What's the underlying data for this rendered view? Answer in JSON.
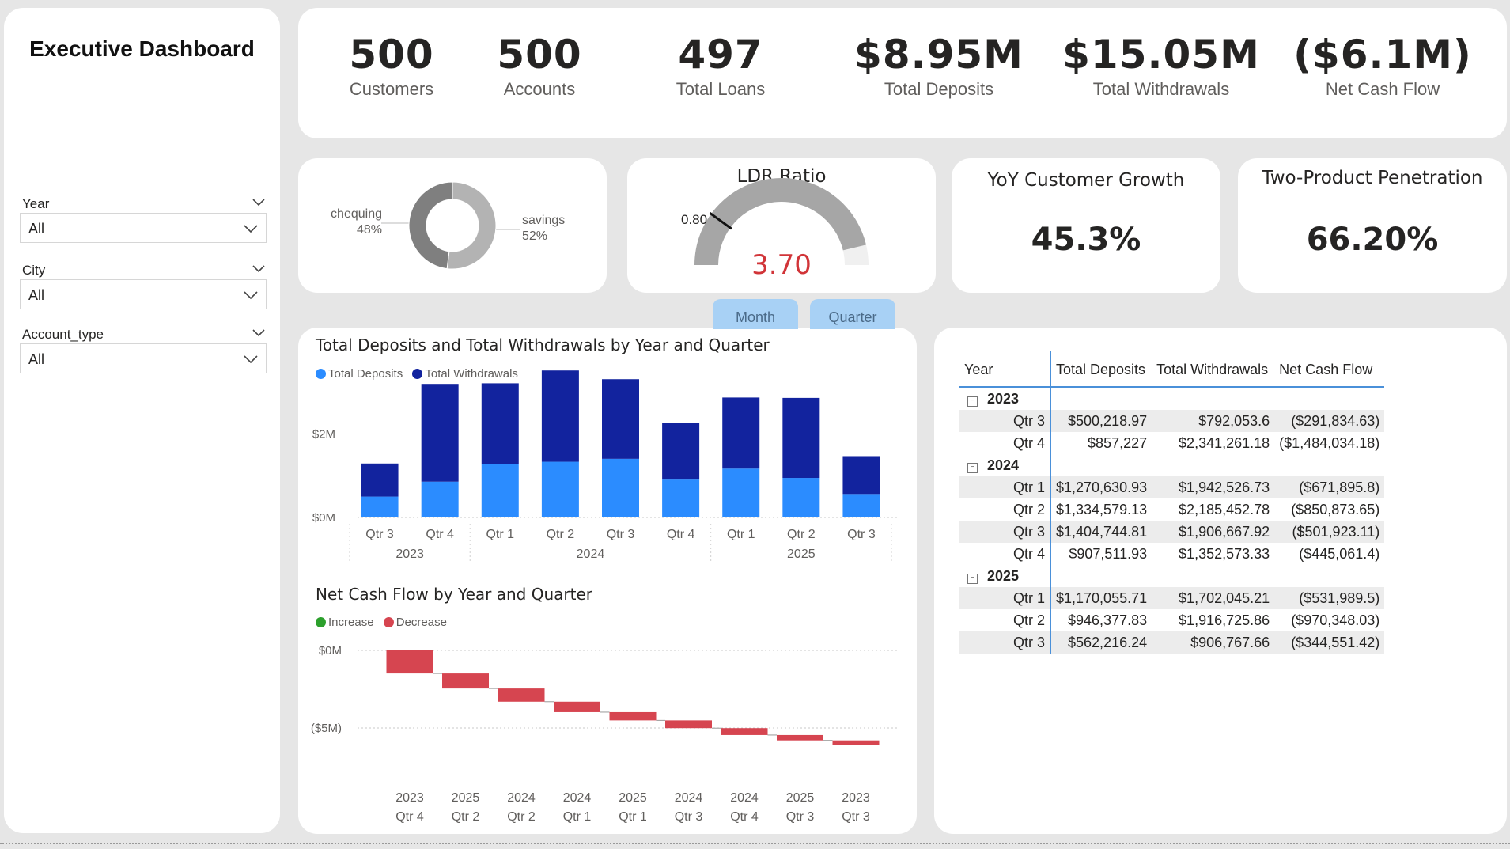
{
  "sidebar": {
    "title": "Executive Dashboard",
    "slicers": [
      {
        "label": "Year",
        "value": "All"
      },
      {
        "label": "City",
        "value": "All"
      },
      {
        "label": "Account_type",
        "value": "All"
      }
    ]
  },
  "kpis": [
    {
      "value": "500",
      "label": "Customers"
    },
    {
      "value": "500",
      "label": "Accounts"
    },
    {
      "value": "497",
      "label": "Total Loans"
    },
    {
      "value": "$8.95M",
      "label": "Total Deposits"
    },
    {
      "value": "$15.05M",
      "label": "Total Withdrawals"
    },
    {
      "value": "($6.1M)",
      "label": "Net Cash Flow"
    }
  ],
  "donut": {
    "slices": [
      {
        "name": "chequing",
        "pct": "48%",
        "value": 48,
        "color": "#7f7f7f"
      },
      {
        "name": "savings",
        "pct": "52%",
        "value": 52,
        "color": "#b3b3b3"
      }
    ]
  },
  "gauge": {
    "title": "LDR Ratio",
    "value": "3.70",
    "target": "0.80",
    "target_value": 0.8,
    "max": 4.0,
    "actual": 3.7,
    "value_color": "#d13438"
  },
  "growth": {
    "title": "YoY Customer Growth",
    "value": "45.3%"
  },
  "penetration": {
    "title": "Two-Product Penetration",
    "value": "66.20%"
  },
  "buttons": {
    "month": "Month",
    "quarter": "Quarter"
  },
  "chart_data": [
    {
      "type": "bar",
      "stacked": true,
      "title": "Total Deposits and Total Withdrawals by Year and Quarter",
      "categories": [
        "Qtr 3",
        "Qtr 4",
        "Qtr 1",
        "Qtr 2",
        "Qtr 3",
        "Qtr 4",
        "Qtr 1",
        "Qtr 2",
        "Qtr 3"
      ],
      "groups": [
        {
          "label": "2023",
          "count": 2
        },
        {
          "label": "2024",
          "count": 4
        },
        {
          "label": "2025",
          "count": 3
        }
      ],
      "series": [
        {
          "name": "Total Deposits",
          "color": "#2b8cff",
          "values": [
            500218.97,
            857227,
            1270630.93,
            1334579.13,
            1404744.81,
            907511.93,
            1170055.71,
            946377.83,
            562216.24
          ]
        },
        {
          "name": "Total Withdrawals",
          "color": "#12239e",
          "values": [
            792053.6,
            2341261.18,
            1942526.73,
            2185452.78,
            1906667.92,
            1352573.33,
            1702045.21,
            1916725.86,
            906767.66
          ]
        }
      ],
      "yticks": [
        {
          "value": 0,
          "label": "$0M"
        },
        {
          "value": 2000000,
          "label": "$2M"
        }
      ],
      "ylim": [
        0,
        3600000
      ],
      "legend": "top-left",
      "grid": true
    },
    {
      "type": "waterfall",
      "title": "Net Cash Flow by Year and Quarter",
      "legend_items": [
        {
          "name": "Increase",
          "color": "#2ca02c"
        },
        {
          "name": "Decrease",
          "color": "#d64550"
        }
      ],
      "categories": [
        {
          "year": "2023",
          "quarter": "Qtr 4"
        },
        {
          "year": "2025",
          "quarter": "Qtr 2"
        },
        {
          "year": "2024",
          "quarter": "Qtr 2"
        },
        {
          "year": "2024",
          "quarter": "Qtr 1"
        },
        {
          "year": "2025",
          "quarter": "Qtr 1"
        },
        {
          "year": "2024",
          "quarter": "Qtr 3"
        },
        {
          "year": "2024",
          "quarter": "Qtr 4"
        },
        {
          "year": "2025",
          "quarter": "Qtr 3"
        },
        {
          "year": "2023",
          "quarter": "Qtr 3"
        }
      ],
      "values": [
        -1484034.18,
        -970348.03,
        -850873.65,
        -671895.8,
        -531989.5,
        -501923.11,
        -445061.4,
        -344551.42,
        -291834.63
      ],
      "yticks": [
        {
          "value": 0,
          "label": "$0M"
        },
        {
          "value": -5000000,
          "label": "($5M)"
        }
      ],
      "ylim": [
        -6800000,
        300000
      ],
      "legend": "top-left",
      "grid": true
    }
  ],
  "matrix": {
    "headers": [
      "Year",
      "Total Deposits",
      "Total Withdrawals",
      "Net Cash Flow"
    ],
    "rows": [
      {
        "kind": "year",
        "label": "2023"
      },
      {
        "kind": "q",
        "label": "Qtr 3",
        "dep": "$500,218.97",
        "wd": "$792,053.6",
        "net": "($291,834.63)"
      },
      {
        "kind": "q",
        "label": "Qtr 4",
        "dep": "$857,227",
        "wd": "$2,341,261.18",
        "net": "($1,484,034.18)"
      },
      {
        "kind": "year",
        "label": "2024"
      },
      {
        "kind": "q",
        "label": "Qtr 1",
        "dep": "$1,270,630.93",
        "wd": "$1,942,526.73",
        "net": "($671,895.8)"
      },
      {
        "kind": "q",
        "label": "Qtr 2",
        "dep": "$1,334,579.13",
        "wd": "$2,185,452.78",
        "net": "($850,873.65)"
      },
      {
        "kind": "q",
        "label": "Qtr 3",
        "dep": "$1,404,744.81",
        "wd": "$1,906,667.92",
        "net": "($501,923.11)"
      },
      {
        "kind": "q",
        "label": "Qtr 4",
        "dep": "$907,511.93",
        "wd": "$1,352,573.33",
        "net": "($445,061.4)"
      },
      {
        "kind": "year",
        "label": "2025"
      },
      {
        "kind": "q",
        "label": "Qtr 1",
        "dep": "$1,170,055.71",
        "wd": "$1,702,045.21",
        "net": "($531,989.5)"
      },
      {
        "kind": "q",
        "label": "Qtr 2",
        "dep": "$946,377.83",
        "wd": "$1,916,725.86",
        "net": "($970,348.03)"
      },
      {
        "kind": "q",
        "label": "Qtr 3",
        "dep": "$562,216.24",
        "wd": "$906,767.66",
        "net": "($344,551.42)"
      }
    ]
  }
}
